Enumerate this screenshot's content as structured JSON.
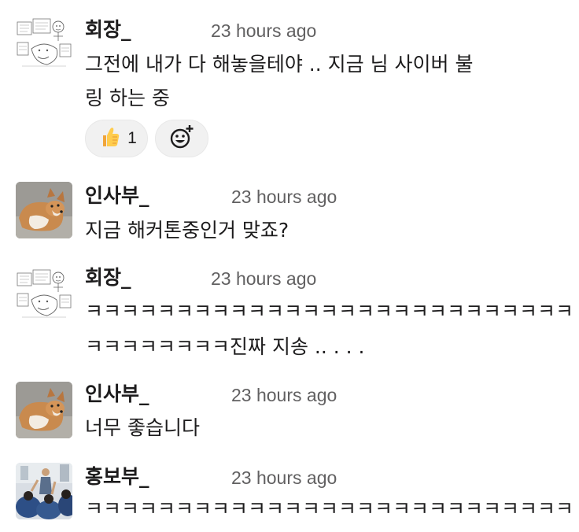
{
  "messages": [
    {
      "author": "회장_",
      "time": "23 hours ago",
      "lines": [
        "그전에 내가 다 해놓을테야 .. 지금          님 사이버 불",
        "링 하는 중"
      ],
      "reactions": [
        {
          "icon": "thumbs-up-icon",
          "count": "1"
        }
      ],
      "avatar": "sketch-drawing-avatar"
    },
    {
      "author": "인사부_",
      "time": "23 hours ago",
      "lines": [
        "지금 해커톤중인거 맞죠?"
      ],
      "avatar": "corgi-dog-avatar"
    },
    {
      "author": "회장_",
      "time": "23 hours ago",
      "lines": [
        "ㅋㅋㅋㅋㅋㅋㅋㅋㅋㅋㅋㅋㅋㅋㅋㅋㅋㅋㅋㅋㅋㅋㅋㅋㅋㅋㅋ",
        "ㅋㅋㅋㅋㅋㅋㅋㅋ진짜 지송 .. . . ."
      ],
      "avatar": "sketch-drawing-avatar"
    },
    {
      "author": "인사부_",
      "time": "23 hours ago",
      "lines": [
        "너무 좋습니다"
      ],
      "avatar": "corgi-dog-avatar"
    },
    {
      "author": "홍보부_",
      "time": "23 hours ago",
      "lines": [
        "ㅋㅋㅋㅋㅋㅋㅋㅋㅋㅋㅋㅋㅋㅋㅋㅋㅋㅋㅋㅋㅋㅋㅋㅋㅋㅋㅋ"
      ],
      "avatar": "group-photo-avatar"
    }
  ],
  "add_reaction_icon": "add-emoji-icon",
  "colors": {
    "text": "#1d1c1d",
    "timestamp": "#616061",
    "reaction_bg": "#f1f1f1"
  }
}
